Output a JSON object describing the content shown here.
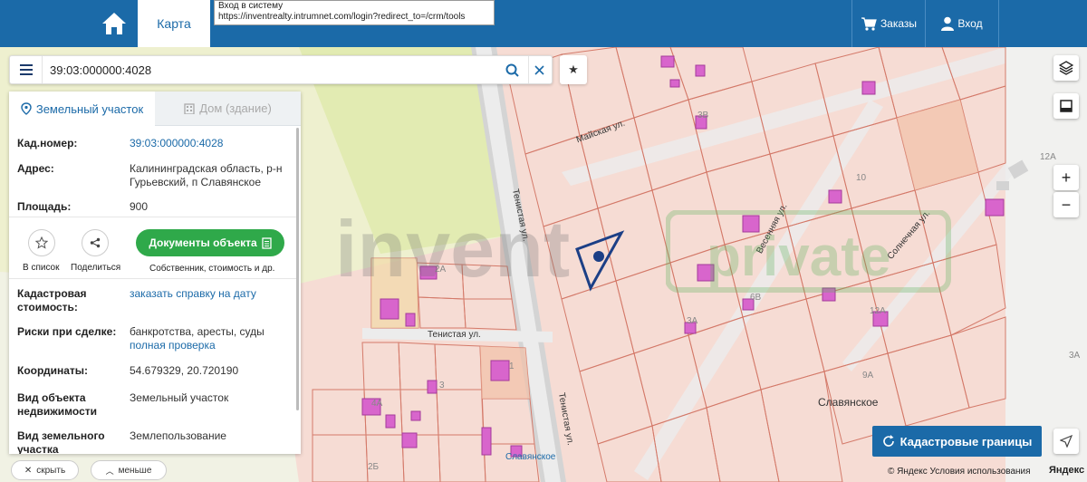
{
  "topbar": {
    "map_tab": "Карта",
    "tooltip_line1": "Вход в систему",
    "tooltip_line2": "https://inventrealty.intrumnet.com/login?redirect_to=/crm/tools",
    "orders": "Заказы",
    "login": "Вход"
  },
  "search": {
    "value": "39:03:000000:4028"
  },
  "panel": {
    "tabs": [
      {
        "label": "Земельный участок",
        "icon": "map-pin-icon"
      },
      {
        "label": "Дом (здание)",
        "icon": "building-icon"
      }
    ],
    "cad_number_label": "Кад.номер:",
    "cad_number_value": "39:03:000000:4028",
    "address_label": "Адрес:",
    "address_value": "Калининградская область, р-н Гурьевский, п Славянское",
    "area_label": "Площадь:",
    "area_value": "900",
    "actions": {
      "add_list": "В список",
      "share": "Поделиться",
      "docs_button": "Документы объекта",
      "docs_sub": "Собственник, стоимость и др."
    },
    "cost_label": "Кадастровая стоимость:",
    "cost_link": "заказать справку на дату",
    "risks_label": "Риски при сделке:",
    "risks_value": "банкротства, аресты, суды",
    "risks_link": "полная проверка",
    "coords_label": "Координаты:",
    "coords_value": "54.679329, 20.720190",
    "type_label": "Вид объекта недвижимости",
    "type_value": "Земельный участок",
    "use_label": "Вид земельного участка",
    "use_value": "Землепользование"
  },
  "bottom": {
    "hide": "скрыть",
    "less": "меньше"
  },
  "map": {
    "street_mayskaya": "Майская ул.",
    "street_tenistaya": "Тенистая ул.",
    "street_tenistaya2": "Тенистая ул.",
    "street_tenistaya3": "Тенистая ул.",
    "street_vesennyaya": "Весенняя ул.",
    "street_solnechnaya": "Солнечная ул.",
    "place_slavyanskoe": "Славянское",
    "place_slavyanskoe2": "Славянское",
    "house_labels": [
      "3В",
      "10",
      "12А",
      "6В",
      "3А",
      "2А",
      "1",
      "3",
      "4А",
      "9А",
      "12А",
      "3А",
      "2Б"
    ],
    "watermark_left": "invent",
    "watermark_right": "private"
  },
  "controls": {
    "cad_borders": "Кадастровые границы",
    "zoom_in": "+",
    "zoom_out": "−",
    "footer": "© Яндекс Условия использования",
    "yandex_brand": "Яндекс"
  }
}
